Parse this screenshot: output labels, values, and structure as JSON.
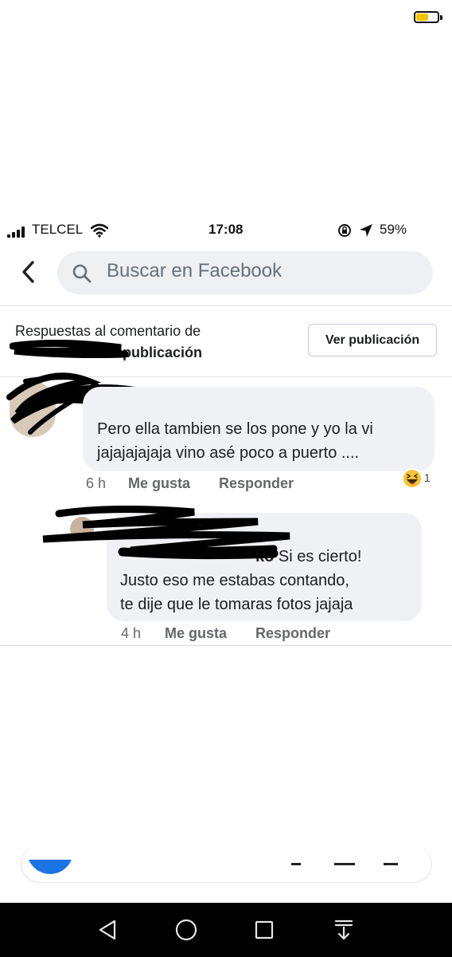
{
  "status_bar": {
    "carrier": "TELCEL",
    "time": "17:08",
    "battery_percent": "59%",
    "battery_level": 0.59,
    "battery_color": "#f5c400"
  },
  "search": {
    "placeholder": "Buscar en Facebook"
  },
  "header": {
    "line1": "Respuestas al comentario de",
    "line2_visible": "publicación",
    "button_label": "Ver publicación"
  },
  "comments": [
    {
      "text_line1": "Pero ella tambien se los pone y yo la vi",
      "text_line2": "jajajajajaja vino asé poco a puerto ....",
      "time": "6 h",
      "like_label": "Me gusta",
      "reply_label": "Responder",
      "reaction_icon": "haha-emoji-icon",
      "reaction_count": "1"
    },
    {
      "name_tail": "ko",
      "text_line1": "Si es cierto!",
      "text_line2": "Justo eso me estabas contando,",
      "text_line3": "te dije que le tomaras fotos jajaja",
      "time": "4 h",
      "like_label": "Me gusta",
      "reply_label": "Responder"
    }
  ],
  "colors": {
    "search_bg": "#eef0f3",
    "bubble_bg": "#eff1f4",
    "meta_text": "#65676b"
  },
  "nav_icons": [
    "back-triangle-icon",
    "home-circle-icon",
    "recents-square-icon",
    "notifications-down-icon"
  ]
}
